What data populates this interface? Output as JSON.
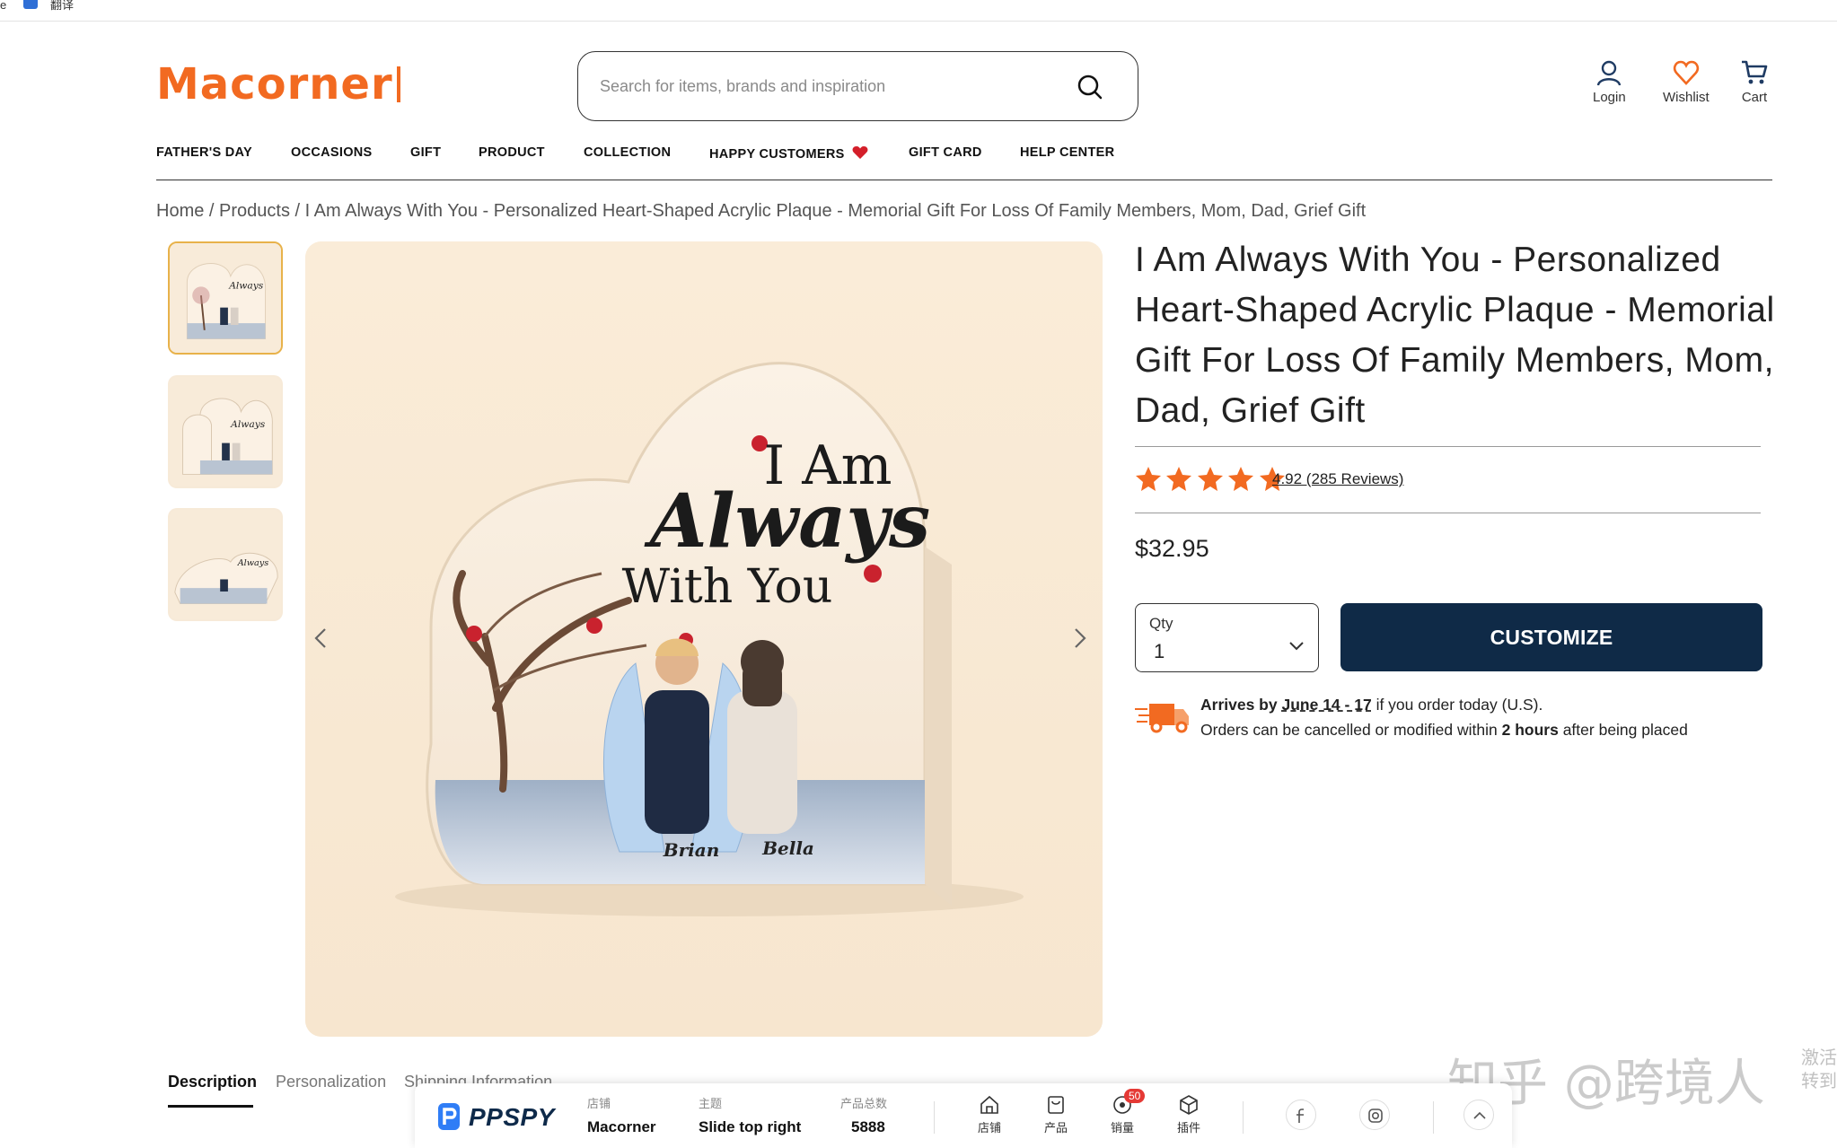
{
  "bookmarks": {
    "item1": "e",
    "item2": "翻译"
  },
  "header": {
    "logo": "Macorner",
    "search_placeholder": "Search for items, brands and inspiration",
    "login": "Login",
    "wishlist": "Wishlist",
    "cart": "Cart"
  },
  "nav": [
    "FATHER'S DAY",
    "OCCASIONS",
    "GIFT",
    "PRODUCT",
    "COLLECTION",
    "HAPPY CUSTOMERS",
    "GIFT CARD",
    "HELP CENTER"
  ],
  "breadcrumb": {
    "home": "Home",
    "products": "Products",
    "current": "I Am Always With You - Personalized Heart-Shaped Acrylic Plaque - Memorial Gift For Loss Of Family Members, Mom, Dad, Grief Gift",
    "sep": " / "
  },
  "product": {
    "title": "I Am Always With You - Personalized Heart-Shaped Acrylic Plaque - Memorial Gift For Loss Of Family Members, Mom, Dad, Grief Gift",
    "rating_text": "4.92 (285 Reviews)",
    "rating_value": 4.92,
    "stars": 5,
    "price": "$32.95",
    "qty_label": "Qty",
    "qty_value": "1",
    "customize": "CUSTOMIZE",
    "image_text": {
      "line1": "I Am",
      "line2": "Always",
      "line3": "With You",
      "name1": "Brian",
      "name2": "Bella"
    }
  },
  "shipping": {
    "arrives_label": "Arrives by",
    "date": "June 14 - 17",
    "arrives_rest": "if you order today (U.S).",
    "line2_pre": "Orders can be cancelled or modified within",
    "line2_bold": "2 hours",
    "line2_post": "after being placed"
  },
  "tabs": [
    "Description",
    "Personalization",
    "Shipping Information"
  ],
  "ppspy": {
    "logo": "PPSPY",
    "store_key": "店铺",
    "store_val": "Macorner",
    "theme_key": "主题",
    "theme_val": "Slide top right",
    "count_key": "产品总数",
    "count_val": "5888",
    "btn_store": "店铺",
    "btn_products": "产品",
    "btn_sales": "销量",
    "btn_plugins": "插件",
    "badge": "50"
  },
  "watermark": {
    "main": "知乎 @跨境人",
    "side1": "激活",
    "side2": "转到"
  },
  "colors": {
    "brand": "#f26a21",
    "button": "#0f2a47",
    "star": "#f26a21"
  }
}
